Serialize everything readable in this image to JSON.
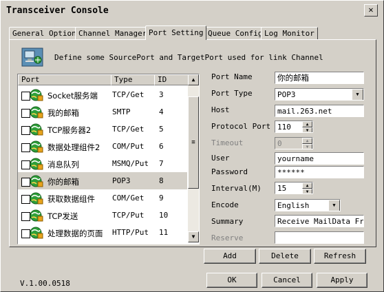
{
  "window": {
    "title": "Transceiver Console",
    "close_glyph": "✕"
  },
  "tabs": [
    {
      "label": "General Option"
    },
    {
      "label": "Channel Manager"
    },
    {
      "label": "Port Setting"
    },
    {
      "label": "Queue Config"
    },
    {
      "label": "Log Monitor"
    }
  ],
  "description": "Define some SourcePort and TargetPort used for link Channel",
  "list": {
    "headers": {
      "port": "Port",
      "type": "Type",
      "id": "ID"
    },
    "rows": [
      {
        "name": "Socket服务端",
        "type": "TCP/Get",
        "id": "3"
      },
      {
        "name": "我的邮箱",
        "type": "SMTP",
        "id": "4"
      },
      {
        "name": "TCP服务器2",
        "type": "TCP/Get",
        "id": "5"
      },
      {
        "name": "数据处理组件2",
        "type": "COM/Put",
        "id": "6"
      },
      {
        "name": "消息队列",
        "type": "MSMQ/Put",
        "id": "7"
      },
      {
        "name": "你的邮箱",
        "type": "POP3",
        "id": "8"
      },
      {
        "name": "获取数据组件",
        "type": "COM/Get",
        "id": "9"
      },
      {
        "name": "TCP发送",
        "type": "TCP/Put",
        "id": "10"
      },
      {
        "name": "处理数据的页面",
        "type": "HTTP/Put",
        "id": "11"
      }
    ],
    "selected_index": 5
  },
  "form": {
    "port_name_label": "Port Name",
    "port_name": "你的邮箱",
    "port_type_label": "Port Type",
    "port_type": "POP3",
    "host_label": "Host",
    "host": "mail.263.net",
    "protocol_port_label": "Protocol Port",
    "protocol_port": "110",
    "timeout_label": "Timeout",
    "timeout": "0",
    "user_label": "User",
    "user": "yourname",
    "password_label": "Password",
    "password": "******",
    "interval_label": "Interval(M)",
    "interval": "15",
    "encode_label": "Encode",
    "encode": "English",
    "summary_label": "Summary",
    "summary": "Receive MailData From",
    "reserve_label": "Reserve",
    "reserve": ""
  },
  "actions": {
    "add": "Add",
    "delete": "Delete",
    "refresh": "Refresh"
  },
  "footer": {
    "version": "V.1.00.0518",
    "ok": "OK",
    "cancel": "Cancel",
    "apply": "Apply"
  }
}
